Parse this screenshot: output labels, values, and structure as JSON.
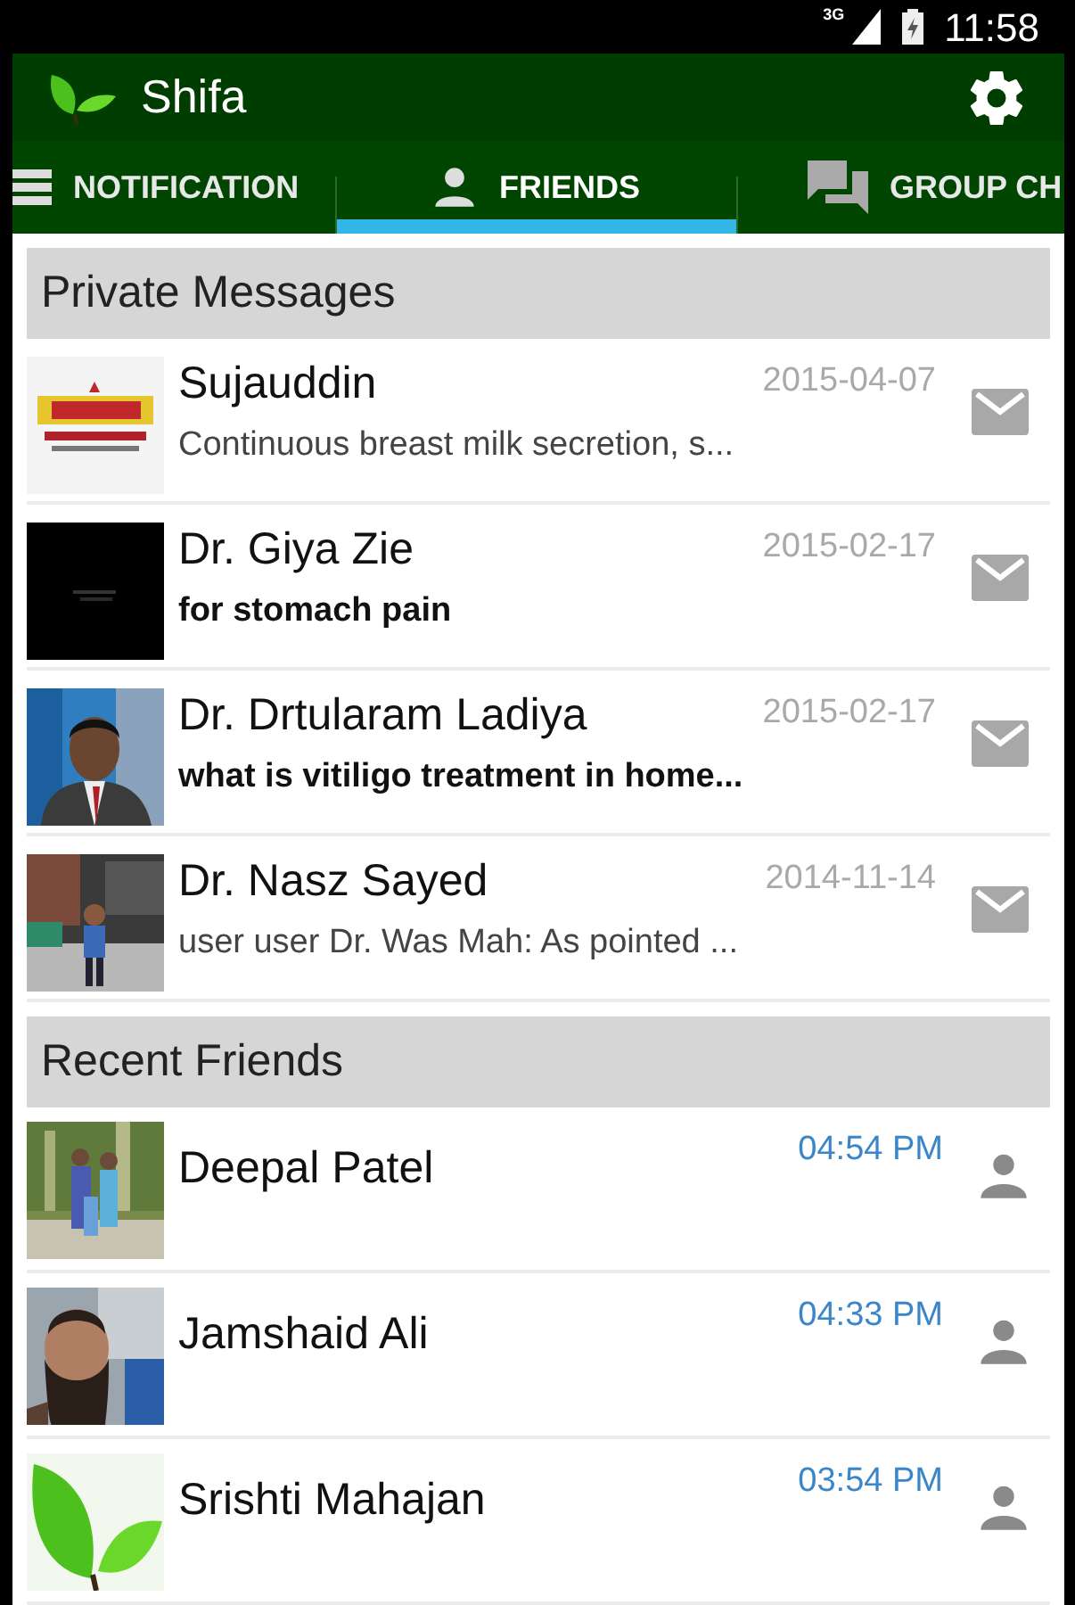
{
  "status_bar": {
    "network": "3G",
    "time": "11:58"
  },
  "app_bar": {
    "title": "Shifa"
  },
  "tabs": [
    {
      "label": "NOTIFICATION",
      "selected": false
    },
    {
      "label": "FRIENDS",
      "selected": true
    },
    {
      "label": "GROUP CH",
      "selected": false
    }
  ],
  "private_messages": {
    "header": "Private Messages",
    "items": [
      {
        "name": "Sujauddin",
        "date": "2015-04-07",
        "message": "Continuous breast milk secretion, s...",
        "unread": false
      },
      {
        "name": "Dr. Giya Zie",
        "date": "2015-02-17",
        "message": "for stomach pain",
        "unread": true
      },
      {
        "name": "Dr. Drtularam Ladiya",
        "date": "2015-02-17",
        "message": "what is vitiligo treatment in home...",
        "unread": true
      },
      {
        "name": "Dr. Nasz Sayed",
        "date": "2014-11-14",
        "message": "user user Dr. Was Mah: As pointed ...",
        "unread": false
      }
    ]
  },
  "recent_friends": {
    "header": "Recent Friends",
    "items": [
      {
        "name": "Deepal Patel",
        "time": "04:54 PM"
      },
      {
        "name": "Jamshaid Ali",
        "time": "04:33 PM"
      },
      {
        "name": "Srishti Mahajan",
        "time": "03:54 PM"
      }
    ]
  }
}
